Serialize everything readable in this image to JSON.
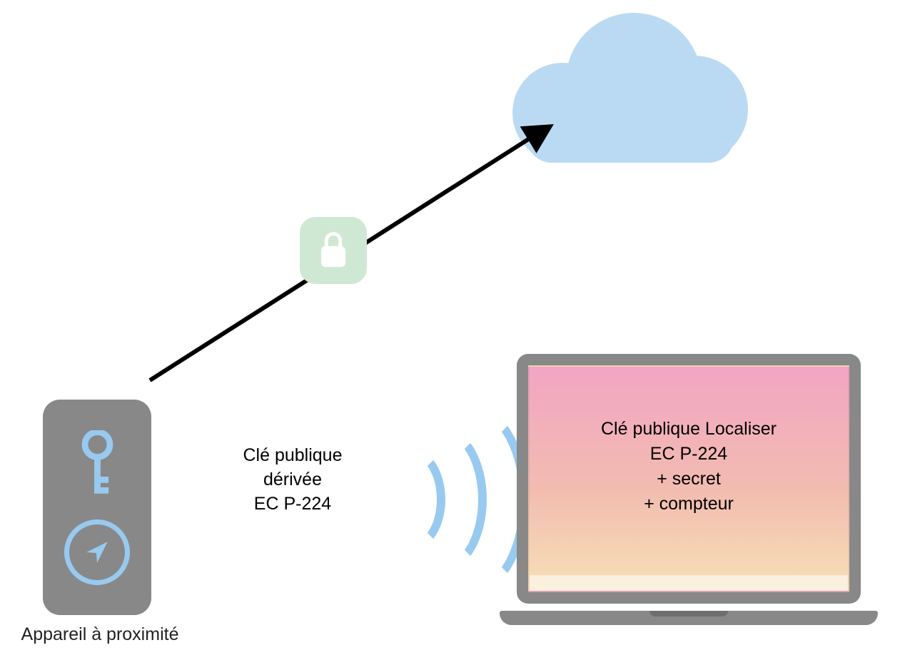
{
  "phone": {
    "caption": "Appareil à proximité"
  },
  "middle": {
    "line1": "Clé publique",
    "line2": "dérivée",
    "line3": "EC P-224"
  },
  "laptop": {
    "line1": "Clé publique Localiser",
    "line2": "EC P-224",
    "line3": "+ secret",
    "line4": "+ compteur"
  },
  "icons": {
    "cloud": "cloud-icon",
    "lock": "lock-icon",
    "key": "key-icon",
    "location": "location-arrow-icon",
    "wifi": "wifi-waves-icon",
    "arrow": "upload-arrow-icon"
  },
  "colors": {
    "blueLight": "#aed4f2",
    "blueIcons": "#98caf0",
    "greenTile": "#cfe8d3",
    "gray": "#888888",
    "black": "#000000",
    "screenTop": "#f2a5c3",
    "screenMid": "#f2bcb0",
    "screenBottom": "#f7e0b5"
  }
}
